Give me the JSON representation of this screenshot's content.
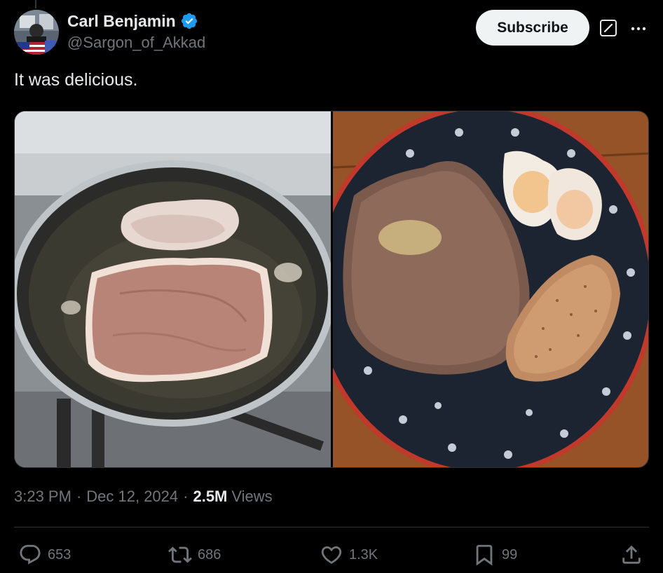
{
  "author": {
    "display_name": "Carl Benjamin",
    "handle": "@Sargon_of_Akkad",
    "verified": true,
    "verified_color": "#1d9bf0"
  },
  "header": {
    "subscribe_label": "Subscribe"
  },
  "tweet": {
    "text": "It was delicious."
  },
  "meta": {
    "time": "3:23 PM",
    "separator": "·",
    "date": "Dec 12, 2024",
    "views_count": "2.5M",
    "views_label": "Views"
  },
  "actions": {
    "replies": "653",
    "reposts": "686",
    "likes": "1.3K",
    "bookmarks": "99"
  },
  "icons": [
    "verified-badge-icon",
    "grok-icon",
    "more-icon",
    "reply-icon",
    "repost-icon",
    "like-icon",
    "bookmark-icon",
    "share-icon"
  ]
}
